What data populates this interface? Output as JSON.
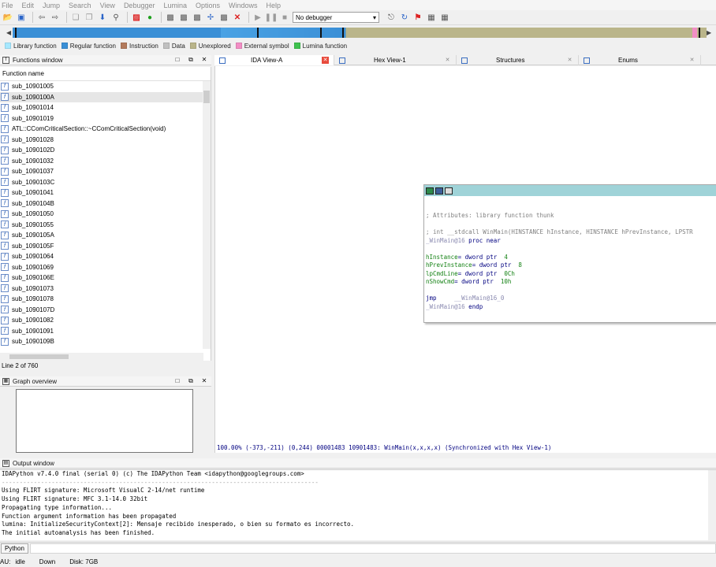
{
  "menu": [
    "File",
    "Edit",
    "Jump",
    "Search",
    "View",
    "Debugger",
    "Lumina",
    "Options",
    "Windows",
    "Help"
  ],
  "toolbar": {
    "debugger_select": "No debugger"
  },
  "legend": [
    {
      "label": "Library function",
      "color": "#a6e8ff"
    },
    {
      "label": "Regular function",
      "color": "#3a8fd6"
    },
    {
      "label": "Instruction",
      "color": "#b37a5c"
    },
    {
      "label": "Data",
      "color": "#c0c0c0"
    },
    {
      "label": "Unexplored",
      "color": "#bab58a"
    },
    {
      "label": "External symbol",
      "color": "#f28ec5"
    },
    {
      "label": "Lumina function",
      "color": "#3fc24f"
    }
  ],
  "functions_window": {
    "title": "Functions window",
    "column_header": "Function name",
    "items": [
      "sub_10901005",
      "sub_1090100A",
      "sub_10901014",
      "sub_10901019",
      "ATL::CComCriticalSection::~CComCriticalSection(void)",
      "sub_10901028",
      "sub_1090102D",
      "sub_10901032",
      "sub_10901037",
      "sub_1090103C",
      "sub_10901041",
      "sub_1090104B",
      "sub_10901050",
      "sub_10901055",
      "sub_1090105A",
      "sub_1090105F",
      "sub_10901064",
      "sub_10901069",
      "sub_1090106E",
      "sub_10901073",
      "sub_10901078",
      "sub_1090107D",
      "sub_10901082",
      "sub_10901091",
      "sub_1090109B"
    ],
    "status": "Line 2 of 760"
  },
  "graph_overview": {
    "title": "Graph overview"
  },
  "tabs": [
    {
      "label": "IDA View-A",
      "icon": "ida-view-icon",
      "active": true
    },
    {
      "label": "Hex View-1",
      "icon": "hex-view-icon",
      "active": false
    },
    {
      "label": "Structures",
      "icon": "structures-icon",
      "active": false
    },
    {
      "label": "Enums",
      "icon": "enums-icon",
      "active": false
    }
  ],
  "graph_node": {
    "comment": "; Attributes: library function thunk",
    "signature": "; int __stdcall WinMain(HINSTANCE hInstance, HINSTANCE hPrevInstance, LPSTR",
    "proc_name": "_WinMain@16",
    "proc_tail": " proc near",
    "vars": [
      {
        "name": "hInstance",
        "rest": "= dword ptr ",
        "num": " 4"
      },
      {
        "name": "hPrevInstance",
        "rest": "= dword ptr ",
        "num": " 8"
      },
      {
        "name": "lpCmdLine",
        "rest": "= dword ptr ",
        "num": " 0Ch"
      },
      {
        "name": "nShowCmd",
        "rest": "= dword ptr ",
        "num": " 10h"
      }
    ],
    "jmp_op": "jmp",
    "jmp_target": "__WinMain@16_0",
    "endp_name": "_WinMain@16",
    "endp_tail": " endp"
  },
  "graph_status": "100.00% (-373,-211) (0,244) 00001483 10901483: WinMain(x,x,x,x) (Synchronized with Hex View-1)",
  "output_window": {
    "title": "Output window",
    "lines": [
      "IDAPython v7.4.0 final (serial 0) (c) The IDAPython Team <idapython@googlegroups.com>",
      "-----------------------------------------------------------------------------------------",
      "Using FLIRT signature: Microsoft VisualC 2-14/net runtime",
      "Using FLIRT signature: MFC 3.1-14.0 32bit",
      "Propagating type information...",
      "Function argument information has been propagated",
      "lumina: InitializeSecurityContext[2]: Mensaje recibido inesperado, o bien su formato es incorrecto.",
      "The initial autoanalysis has been finished."
    ]
  },
  "python_button": "Python",
  "statusbar": {
    "au": "AU:",
    "state": "idle",
    "direction": "Down",
    "disk": "Disk: 7GB"
  }
}
